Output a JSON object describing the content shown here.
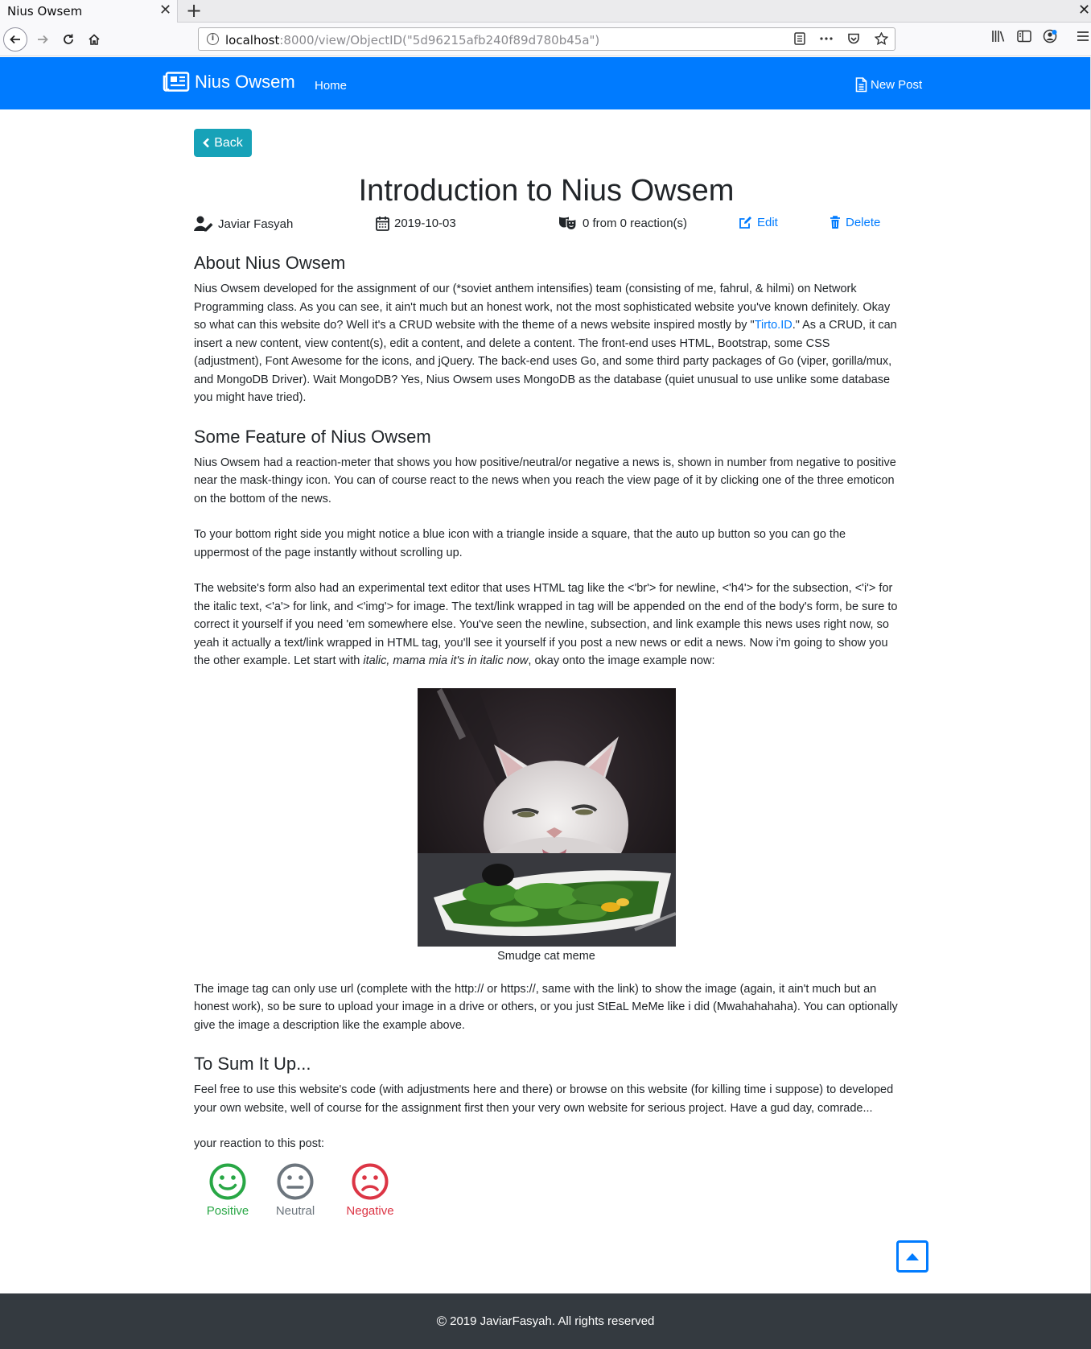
{
  "browser": {
    "tab_title": "Nius Owsem",
    "tab_close": "✕",
    "new_tab": "+",
    "window_close": "✕",
    "url_host": "localhost",
    "url_rest": ":8000/view/ObjectID(\"5d96215afb240f89d780b45a\")",
    "url_icons": [
      "reader-view-icon",
      "more-icon",
      "pocket-icon",
      "bookmark-star-icon"
    ],
    "toolbar_icons": [
      "library-icon",
      "sidebar-icon",
      "account-icon",
      "menu-icon"
    ]
  },
  "navbar": {
    "brand": "Nius Owsem",
    "home": "Home",
    "new_post": "New Post",
    "bg_color": "#007bff"
  },
  "post": {
    "back_label": "Back",
    "title": "Introduction to Nius Owsem",
    "author": "Javiar Fasyah",
    "date": "2019-10-03",
    "reactions": "0 from 0 reaction(s)",
    "edit_label": "Edit",
    "delete_label": "Delete"
  },
  "sections": {
    "about_heading": "About Nius Owsem",
    "about_p1_a": "Nius Owsem developed for the assignment of our (*soviet anthem intensifies) team (consisting of me, fahrul, & hilmi) on Network Programming class. As you can see, it ain't much but an honest work, not the most sophisticated website you've known definitely. Okay so what can this website do? Well it's a CRUD website with the theme of a news website inspired mostly by \"",
    "about_link": "Tirto.ID",
    "about_p1_b": ".\" As a CRUD, it can insert a new content, view content(s), edit a content, and delete a content. The front-end uses HTML, Bootstrap, some CSS (adjustment), Font Awesome for the icons, and jQuery. The back-end uses Go, and some third party packages of Go (viper, gorilla/mux, and MongoDB Driver). Wait MongoDB? Yes, Nius Owsem uses MongoDB as the database (quiet unusual to use unlike some database you might have tried).",
    "feature_heading": "Some Feature of Nius Owsem",
    "feature_p1": "Nius Owsem had a reaction-meter that shows you how positive/neutral/or negative a news is, shown in number from negative to positive near the mask-thingy icon. You can of course react to the news when you reach the view page of it by clicking one of the three emoticon on the bottom of the news.",
    "feature_p2": "To your bottom right side you might notice a blue icon with a triangle inside a square, that the auto up button so you can go the uppermost of the page instantly without scrolling up.",
    "feature_p3_a": "The website's form also had an experimental text editor that uses HTML tag like the <'br'> for newline, <'h4'> for the subsection, <'i'> for the italic text, <'a'> for link, and <'img'> for image. The text/link wrapped in tag will be appended on the end of the body's form, be sure to correct it yourself if you need 'em somewhere else. You've seen the newline, subsection, and link example this news uses right now, so yeah it actually a text/link wrapped in HTML tag, you'll see it yourself if you post a new news or edit a news. Now i'm going to show you the other example. Let start with ",
    "feature_p3_italic": "italic, mama mia it's in italic now",
    "feature_p3_b": ", okay onto the image example now:",
    "image_caption": "Smudge cat meme",
    "image_p": "The image tag can only use url (complete with the http:// or https://, same with the link) to show the image (again, it ain't much but an honest work), so be sure to upload your image in a drive or others, or you just StEaL MeMe like i did (Mwahahahaha). You can optionally give the image a description like the example above.",
    "sum_heading": "To Sum It Up...",
    "sum_p": "Feel free to use this website's code (with adjustments here and there) or browse on this website (for killing time i suppose) to developed your own website, well of course for the assignment first then your very own website for serious project. Have a gud day, comrade..."
  },
  "reaction_prompt": "your reaction to this post:",
  "reactions": {
    "positive": "Positive",
    "neutral": "Neutral",
    "negative": "Negative",
    "positive_color": "#28a745",
    "neutral_color": "#6c757d",
    "negative_color": "#dc3545"
  },
  "footer": {
    "text": "2019 JaviarFasyah. All rights reserved",
    "copyright_symbol": "©"
  }
}
